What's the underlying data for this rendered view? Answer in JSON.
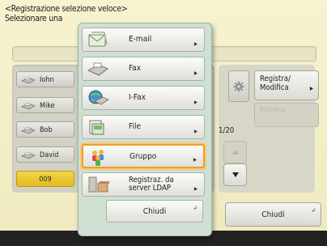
{
  "header": {
    "title_line1": "<Registrazione selezione veloce>",
    "title_line2": "Selezionare una"
  },
  "address_list": {
    "entries": [
      {
        "label": "Iohn",
        "icon": "fax-icon"
      },
      {
        "label": "Mike",
        "icon": "fax-icon"
      },
      {
        "label": "Bob",
        "icon": "fax-icon"
      },
      {
        "label": "David",
        "icon": "fax-icon"
      },
      {
        "label": "009",
        "icon": "group-entry"
      }
    ]
  },
  "side_panel": {
    "register_label": "Registra/ Modifica",
    "delete_label": "Elimina",
    "page_indicator": "1/20"
  },
  "popup_menu": {
    "items": [
      {
        "label": "E-mail",
        "icon": "email-icon"
      },
      {
        "label": "Fax",
        "icon": "fax-icon"
      },
      {
        "label": "I-Fax",
        "icon": "ifax-icon"
      },
      {
        "label": "File",
        "icon": "file-icon"
      },
      {
        "label": "Gruppo",
        "icon": "group-icon",
        "selected": true
      },
      {
        "label": "Registraz. da server LDAP",
        "icon": "ldap-server-icon"
      }
    ],
    "close_label": "Chiudi"
  },
  "footer": {
    "close_label": "Chiudi"
  },
  "colors": {
    "background": "#f3efc8",
    "selection_highlight": "#f19c2b",
    "group_entry": "#e8c22a",
    "popup_background": "#cfe0d2"
  }
}
